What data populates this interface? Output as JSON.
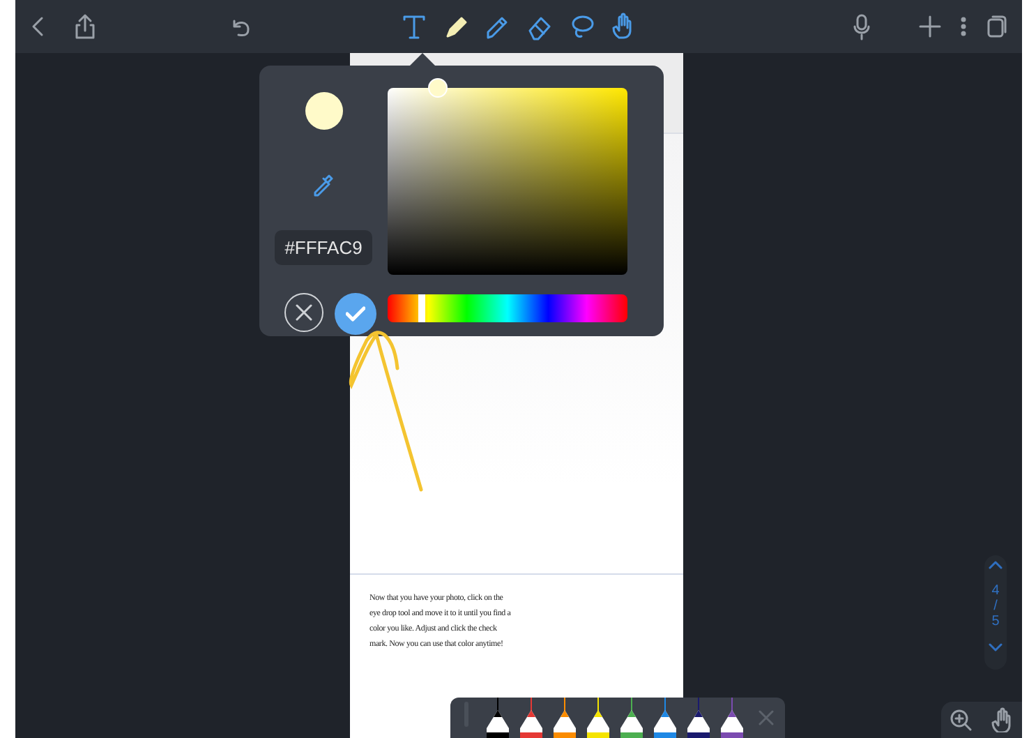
{
  "toolbar": {
    "tools": [
      {
        "kind": "text",
        "selected": false
      },
      {
        "kind": "pen",
        "selected": true
      },
      {
        "kind": "highlighter",
        "selected": false
      },
      {
        "kind": "eraser",
        "selected": false
      },
      {
        "kind": "lasso",
        "selected": false
      },
      {
        "kind": "hand",
        "selected": false
      }
    ]
  },
  "color_picker": {
    "color": "#fffac9",
    "hex_value": "#FFFAC9",
    "hue_slider": {
      "level": 0.14
    }
  },
  "page": {
    "text": "Now that you have your photo, click on the eye drop tool and move it to it until you find a color you like. Adjust and click the check mark. Now you can use that color anytime!"
  },
  "page_indicator": {
    "current": "4",
    "separator": "/",
    "total": "5"
  },
  "pen_tray": {
    "pens": [
      {
        "color": "#000000"
      },
      {
        "color": "#e53935"
      },
      {
        "color": "#fb8c00"
      },
      {
        "color": "#f5e400"
      },
      {
        "color": "#4caf50"
      },
      {
        "color": "#1e88e5"
      },
      {
        "color": "#1a1a6e"
      },
      {
        "color": "#7b4bb0"
      }
    ]
  }
}
